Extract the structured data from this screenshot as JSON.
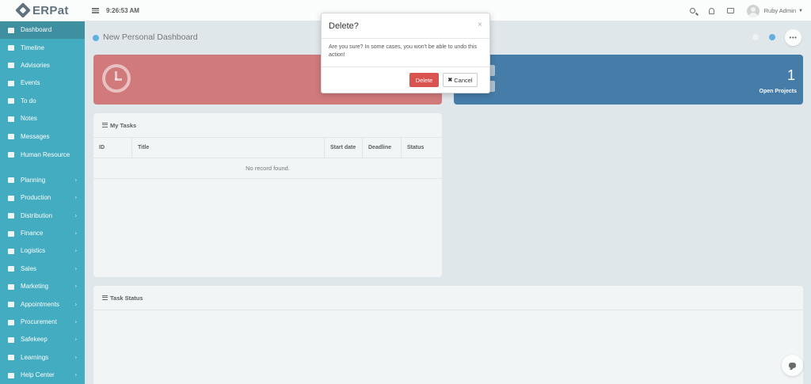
{
  "app": {
    "logo_text": "ERPat"
  },
  "header": {
    "time": "9:26:53 AM",
    "user_name": "Ruby Admin"
  },
  "sidebar": {
    "items": [
      {
        "label": "Dashboard",
        "icon": "monitor-icon",
        "active": true
      },
      {
        "label": "Timeline",
        "icon": "timeline-icon"
      },
      {
        "label": "Advisories",
        "icon": "megaphone-icon"
      },
      {
        "label": "Events",
        "icon": "calendar-icon"
      },
      {
        "label": "To do",
        "icon": "checkbox-icon"
      },
      {
        "label": "Notes",
        "icon": "notes-icon"
      },
      {
        "label": "Messages",
        "icon": "envelope-icon"
      },
      {
        "label": "Human Resource",
        "icon": "users-icon"
      },
      {
        "label": "Planning",
        "icon": "briefcase-icon",
        "has_children": true
      },
      {
        "label": "Production",
        "icon": "flask-icon",
        "has_children": true
      },
      {
        "label": "Distribution",
        "icon": "bank-icon",
        "has_children": true
      },
      {
        "label": "Finance",
        "icon": "money-icon",
        "has_children": true
      },
      {
        "label": "Logistics",
        "icon": "truck-icon",
        "has_children": true
      },
      {
        "label": "Sales",
        "icon": "cart-icon",
        "has_children": true
      },
      {
        "label": "Marketing",
        "icon": "chart-line-icon",
        "has_children": true
      },
      {
        "label": "Appointments",
        "icon": "edit-icon",
        "has_children": true
      },
      {
        "label": "Procurement",
        "icon": "cubes-icon",
        "has_children": true
      },
      {
        "label": "Safekeep",
        "icon": "archive-icon",
        "has_children": true
      },
      {
        "label": "Learnings",
        "icon": "graduation-cap-icon",
        "has_children": true
      },
      {
        "label": "Help Center",
        "icon": "help-circle-icon",
        "has_children": true
      }
    ]
  },
  "main": {
    "dashboard_title": "New Personal Dashboard",
    "open_projects": {
      "value": "1",
      "label": "Open Projects"
    },
    "my_tasks": {
      "title": "My Tasks",
      "columns": [
        "ID",
        "Title",
        "Start date",
        "Deadline",
        "Status"
      ],
      "empty_text": "No record found."
    },
    "task_status": {
      "title": "Task Status"
    }
  },
  "modal": {
    "title": "Delete?",
    "close_glyph": "×",
    "message": "Are you sure? In some cases, you won't be able to undo this action!",
    "delete_label": "Delete",
    "cancel_label": "Cancel"
  },
  "colors": {
    "sidebar": "#1598b2",
    "sidebar_active": "#0d7388",
    "card_red": "#c9585a",
    "card_blue": "#185a93",
    "danger": "#d9534f",
    "accent_dot": "#3d9bdc"
  }
}
